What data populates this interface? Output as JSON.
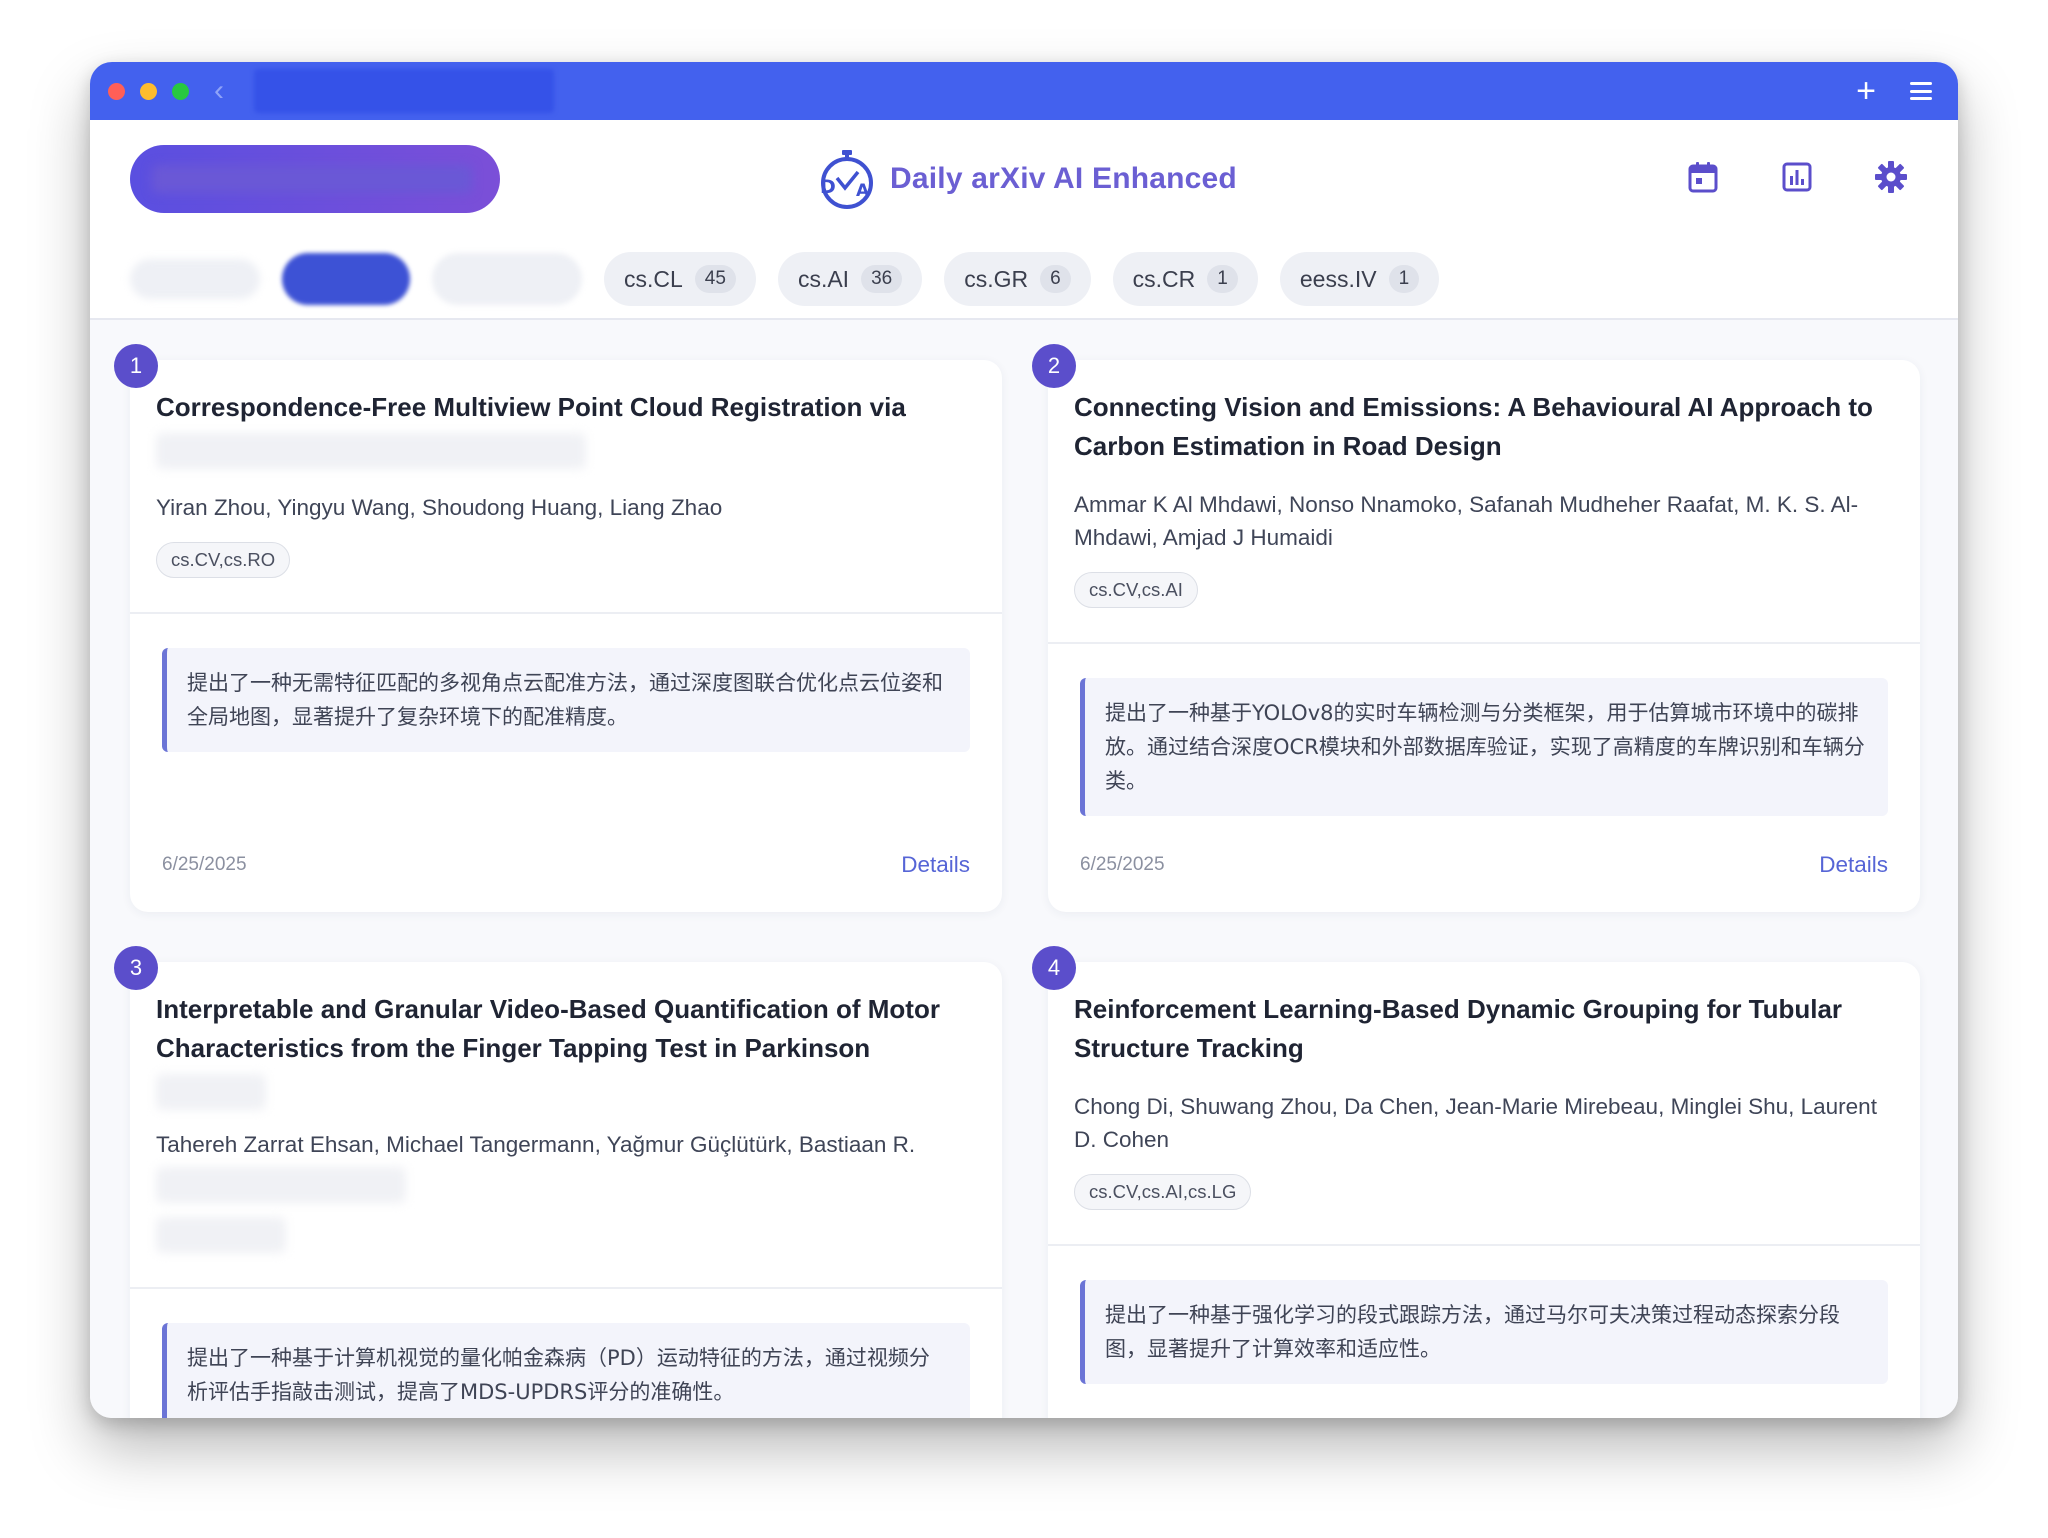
{
  "app": {
    "title": "Daily arXiv AI Enhanced"
  },
  "titlebar": {
    "back_glyph": "‹",
    "new_tab_glyph": "+",
    "icons": [
      "chevron-left-icon",
      "plus-icon",
      "menu-icon"
    ]
  },
  "header": {
    "icons": [
      "calendar-icon",
      "bar-chart-icon",
      "gear-icon"
    ]
  },
  "tabs": [
    {
      "label": "cs.CL",
      "count": "45"
    },
    {
      "label": "cs.AI",
      "count": "36"
    },
    {
      "label": "cs.GR",
      "count": "6"
    },
    {
      "label": "cs.CR",
      "count": "1"
    },
    {
      "label": "eess.IV",
      "count": "1"
    }
  ],
  "papers": [
    {
      "number": "1",
      "title": "Correspondence-Free Multiview Point Cloud Registration via",
      "authors": "Yiran Zhou, Yingyu Wang, Shoudong Huang, Liang Zhao",
      "tags": "cs.CV,cs.RO",
      "summary": "提出了一种无需特征匹配的多视角点云配准方法，通过深度图联合优化点云位姿和全局地图，显著提升了复杂环境下的配准精度。",
      "date": "6/25/2025",
      "details_label": "Details"
    },
    {
      "number": "2",
      "title": "Connecting Vision and Emissions: A Behavioural AI Approach to Carbon Estimation in Road Design",
      "authors": "Ammar K Al Mhdawi, Nonso Nnamoko, Safanah Mudheher Raafat, M. K. S. Al-Mhdawi, Amjad J Humaidi",
      "tags": "cs.CV,cs.AI",
      "summary": "提出了一种基于YOLOv8的实时车辆检测与分类框架，用于估算城市环境中的碳排放。通过结合深度OCR模块和外部数据库验证，实现了高精度的车牌识别和车辆分类。",
      "date": "6/25/2025",
      "details_label": "Details"
    },
    {
      "number": "3",
      "title": "Interpretable and Granular Video-Based Quantification of Motor Characteristics from the Finger Tapping Test in Parkinson",
      "authors": "Tahereh Zarrat Ehsan, Michael Tangermann, Yağmur Güçlütürk, Bastiaan R.",
      "summary": "提出了一种基于计算机视觉的量化帕金森病（PD）运动特征的方法，通过视频分析评估手指敲击测试，提高了MDS-UPDRS评分的准确性。"
    },
    {
      "number": "4",
      "title": "Reinforcement Learning-Based Dynamic Grouping for Tubular Structure Tracking",
      "authors": "Chong Di, Shuwang Zhou, Da Chen, Jean-Marie Mirebeau, Minglei Shu, Laurent D. Cohen",
      "tags": "cs.CV,cs.AI,cs.LG",
      "summary": "提出了一种基于强化学习的段式跟踪方法，通过马尔可夫决策过程动态探索分段图，显著提升了计算效率和适应性。"
    }
  ],
  "colors": {
    "titlebar": "#4361ee",
    "accent": "#5b4ecb",
    "brand_text": "#6b5fd3",
    "link": "#5665d6"
  }
}
